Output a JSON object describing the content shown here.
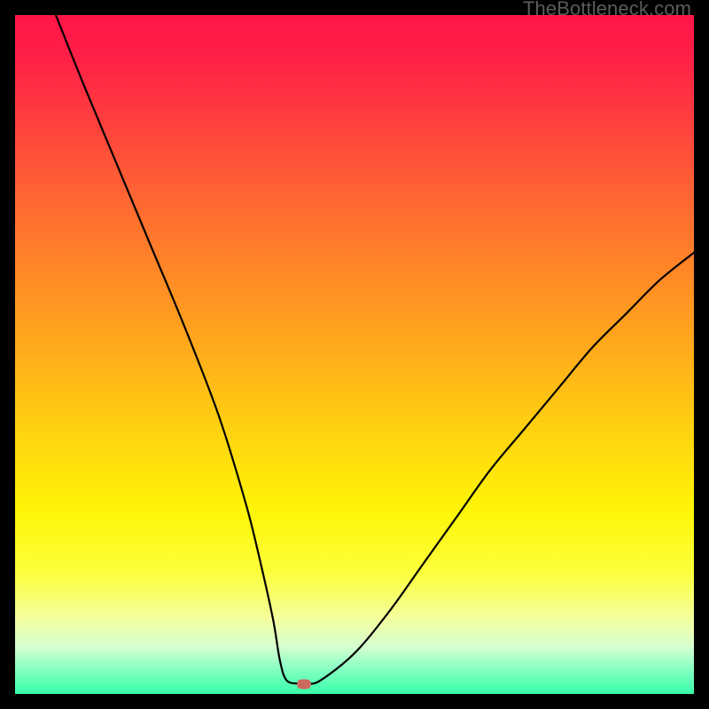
{
  "watermark": "TheBottleneck.com",
  "colors": {
    "frame": "#000000",
    "curve": "#000000",
    "marker": "#cc6a5f"
  },
  "chart_data": {
    "type": "line",
    "title": "",
    "xlabel": "",
    "ylabel": "",
    "xlim": [
      0,
      100
    ],
    "ylim": [
      0,
      100
    ],
    "grid": false,
    "legend": false,
    "series": [
      {
        "name": "bottleneck-curve",
        "x": [
          6,
          10,
          15,
          20,
          25,
          30,
          34,
          36,
          38,
          39,
          40,
          42,
          43,
          45,
          50,
          55,
          60,
          65,
          70,
          75,
          80,
          85,
          90,
          95,
          100
        ],
        "y": [
          100,
          90,
          78,
          66,
          54,
          41,
          28,
          20,
          11,
          5,
          2,
          1.5,
          1.5,
          2,
          6,
          12,
          19,
          26,
          33,
          39,
          45,
          51,
          56,
          61,
          65
        ]
      }
    ],
    "marker": {
      "x": 42.5,
      "y": 1.5
    }
  }
}
